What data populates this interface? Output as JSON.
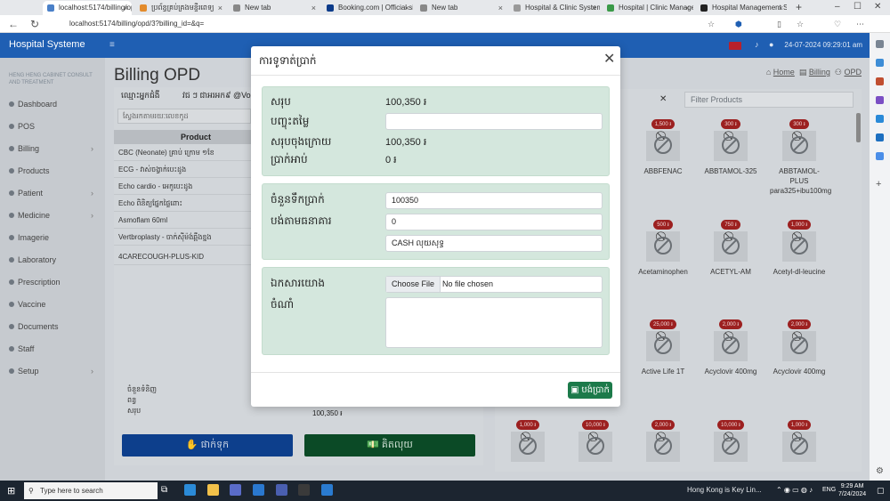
{
  "browser": {
    "tabs": [
      {
        "label": "localhost:5174/billing/opd?billing_id",
        "active": true
      },
      {
        "label": "ប្រព័ន្ធគ្រប់គ្រងមន្ទីរពេទ្យ"
      },
      {
        "label": "New tab"
      },
      {
        "label": "Booking.com | Official site"
      },
      {
        "label": "New tab"
      },
      {
        "label": "Hospital & Clinic System"
      },
      {
        "label": "Hospital | Clinic Manage"
      },
      {
        "label": "Hospital Management Sy"
      }
    ],
    "url": "localhost:5174/billing/opd/3?billing_id=&q="
  },
  "app": {
    "brand": "Hospital Systeme",
    "header_date": "24-07-2024 09:29:01 am",
    "company": "HENG HENG CABINET CONSULT AND TREATMENT",
    "sidebar": [
      {
        "label": "Dashboard",
        "chev": false
      },
      {
        "label": "POS",
        "chev": false
      },
      {
        "label": "Billing",
        "chev": true
      },
      {
        "label": "Products",
        "chev": false
      },
      {
        "label": "Patient",
        "chev": true
      },
      {
        "label": "Medicine",
        "chev": true
      },
      {
        "label": "Imagerie",
        "chev": false
      },
      {
        "label": "Laboratory",
        "chev": false
      },
      {
        "label": "Prescription",
        "chev": false
      },
      {
        "label": "Vaccine",
        "chev": false
      },
      {
        "label": "Documents",
        "chev": false
      },
      {
        "label": "Staff",
        "chev": false
      },
      {
        "label": "Setup",
        "chev": true
      }
    ],
    "page_title": "Billing OPD",
    "breadcrumbs": [
      "Home",
      "Billing",
      "OPD"
    ],
    "patient_label": "ឈ្មោះអ្នកជំងឺ",
    "patient_value": "វជ ៗ ជាអរអក៩ @Von",
    "search_placeholder": "ស្វែងរកតាមរយៈលេខកូដ",
    "product_head": "Product",
    "products": [
      "CBC (Neonate) គ្រាប់ ក្រោម ១ខែ",
      "ECG - វាស់ចង្វាក់បេះដូង",
      "Echo cardio - អេកូបេះដូង",
      "Echo ពិនិត្យផ្នែកផ្ទៃពោះ",
      "Asmoflam 60ml",
      "Vertbroplasty - ចាក់ស៊ីម៉ង់ឆ្អឹងខ្នង",
      "4CARECOUGH-PLUS-KID"
    ],
    "summary_labels": [
      "ចំនួនទំនិញ",
      "ពន្ធ",
      "សរុប"
    ],
    "summary_total": "100,350 ៛",
    "hold_button": "ផាក់ទុក",
    "pay_button": "គិតលុយ",
    "filter_placeholder": "Filter Products",
    "nophoto": "No photo",
    "cards_row1": [
      {
        "price": "1,500 ៛",
        "name": "ABBFENAC"
      },
      {
        "price": "300 ៛",
        "name": "ABBTAMOL-325"
      },
      {
        "price": "300 ៛",
        "name": "ABBTAMOL-PLUS para325+ibu100mg"
      }
    ],
    "cards_row2": [
      {
        "price": "500 ៛",
        "name": "Acetaminophen"
      },
      {
        "price": "750 ៛",
        "name": "ACETYL-AM"
      },
      {
        "price": "1,000 ៛",
        "name": "Acetyl-dl-leucine"
      }
    ],
    "cards_row3": [
      {
        "price": "25,000 ៛",
        "name": "Active Life 1T"
      },
      {
        "price": "2,000 ៛",
        "name": "Acyclovir 400mg"
      },
      {
        "price": "2,000 ៛",
        "name": "Acyclovir 400mg"
      }
    ],
    "cards_row4": [
      {
        "price": "1,000 ៛"
      },
      {
        "price": "10,000 ៛"
      },
      {
        "price": "2,000 ៛"
      },
      {
        "price": "10,000 ៛"
      },
      {
        "price": "1,000 ៛"
      }
    ]
  },
  "modal": {
    "title": "ការទូទាត់ប្រាក់",
    "total_label": "សរុប",
    "total_value": "100,350 ៛",
    "discount_label": "បញ្ចុះតម្លៃ",
    "discount_value": "",
    "grand_total_label": "សរុបចុងក្រោយ",
    "grand_total_value": "100,350 ៛",
    "change_label": "ប្រាក់អាប់",
    "change_value": "0 ៛",
    "amount_label": "ចំនួនទឹកប្រាក់",
    "amount_value": "100350",
    "bank_label": "បង់តាមធនាគារ",
    "bank_value": "0",
    "method_value": "CASH លុយសុទ្ធ",
    "reference_label": "ឯកសារយោង",
    "file_button": "Choose File",
    "file_text": "No file chosen",
    "note_label": "ចំណាំ",
    "note_value": "",
    "confirm_button": "បង់ប្រាក់"
  },
  "taskbar": {
    "search_placeholder": "Type here to search",
    "news": "Hong Kong is Key Lin...",
    "lang": "ENG",
    "time": "9:29 AM",
    "date": "7/24/2024"
  }
}
